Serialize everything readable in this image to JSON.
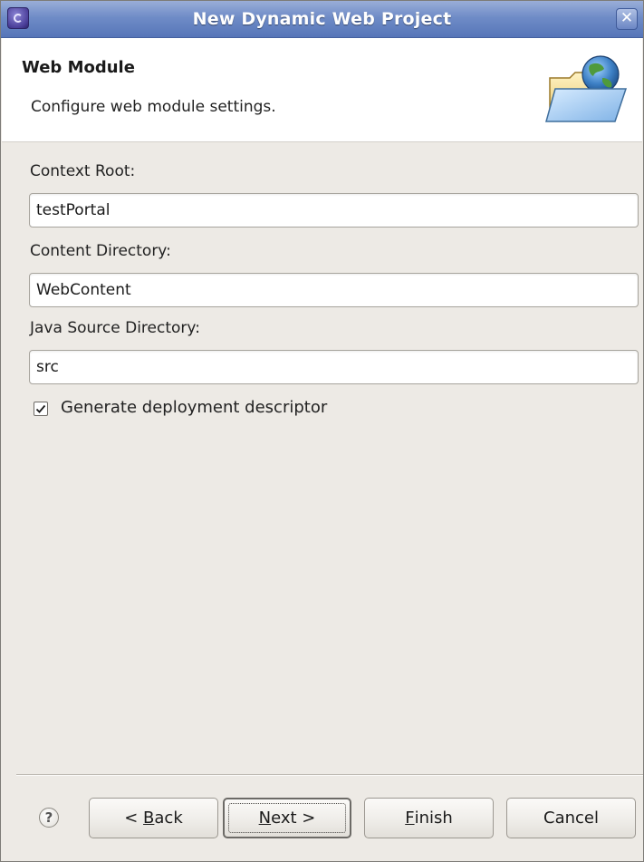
{
  "window": {
    "title": "New Dynamic Web Project",
    "close_glyph": "✕"
  },
  "header": {
    "title": "Web Module",
    "description": "Configure web module settings.",
    "icon": "folder-globe-icon"
  },
  "form": {
    "context_root": {
      "label": "Context Root:",
      "value": "testPortal"
    },
    "content_directory": {
      "label": "Content Directory:",
      "value": "WebContent"
    },
    "java_source_directory": {
      "label": "Java Source Directory:",
      "value": "src"
    },
    "generate_descriptor": {
      "label": "Generate deployment descriptor",
      "checked": true
    }
  },
  "footer": {
    "help_glyph": "?",
    "back": {
      "mnemonic": "B",
      "prefix": "< ",
      "rest": "ack"
    },
    "next": {
      "mnemonic": "N",
      "prefix": "",
      "rest": "ext >"
    },
    "finish": {
      "mnemonic": "F",
      "prefix": "",
      "rest": "inish"
    },
    "cancel": {
      "label": "Cancel"
    }
  },
  "colors": {
    "titlebar": "#6f8cc7",
    "dialog_bg": "#edeae5",
    "header_bg": "#ffffff"
  }
}
